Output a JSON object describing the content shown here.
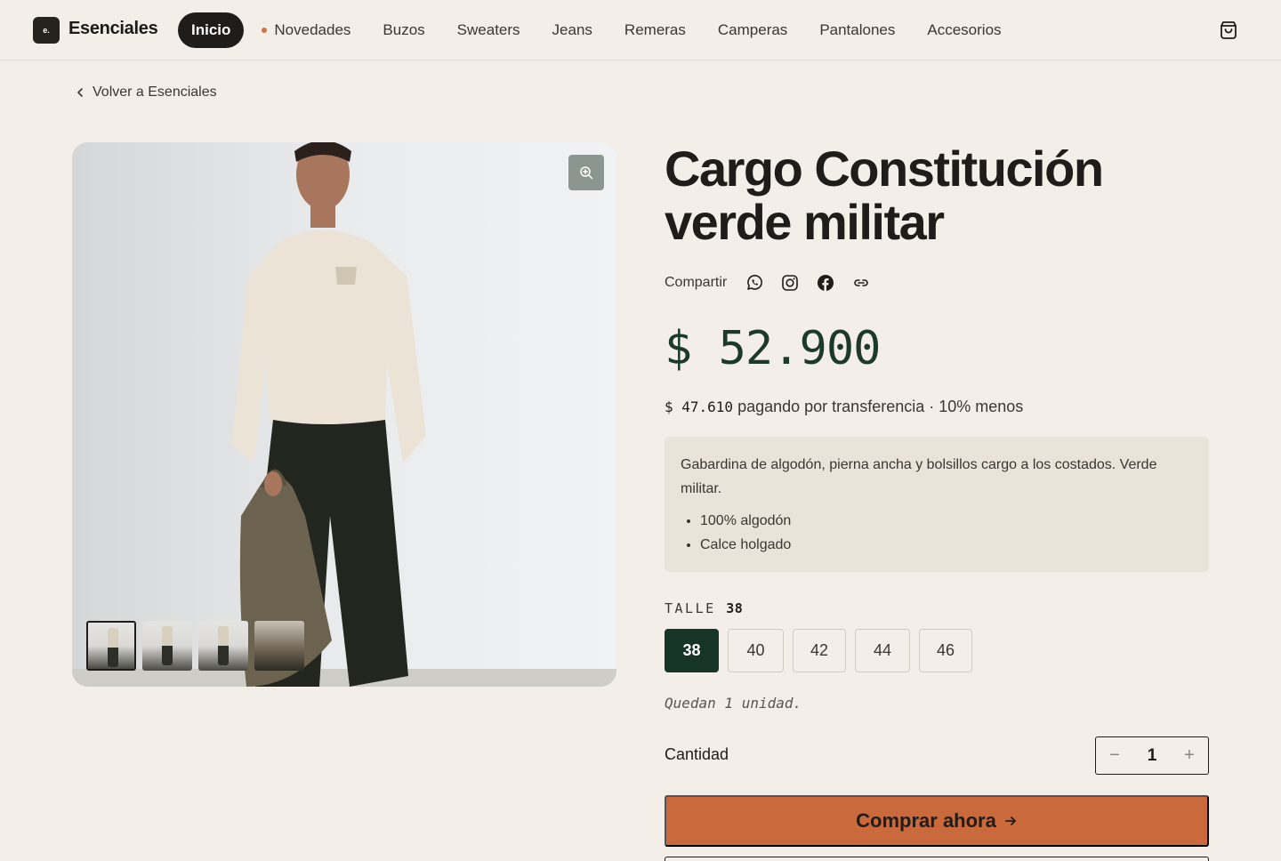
{
  "header": {
    "logo_text": "e.",
    "brand": "Esenciales",
    "nav": [
      {
        "label": "Inicio",
        "active": true
      },
      {
        "label": "Novedades",
        "dot": true
      },
      {
        "label": "Buzos"
      },
      {
        "label": "Sweaters"
      },
      {
        "label": "Jeans"
      },
      {
        "label": "Remeras"
      },
      {
        "label": "Camperas"
      },
      {
        "label": "Pantalones"
      },
      {
        "label": "Accesorios"
      }
    ],
    "cart_icon": "shopping-bag-icon"
  },
  "back_link": "Volver a Esenciales",
  "gallery": {
    "zoom_icon": "zoom-in-icon",
    "thumbnail_count": 4,
    "selected_thumbnail": 1
  },
  "product": {
    "title": "Cargo Constitución verde militar",
    "share_label": "Compartir",
    "share_icons": [
      "whatsapp-icon",
      "instagram-icon",
      "facebook-icon",
      "link-icon"
    ],
    "price": "$ 52.900",
    "transfer_price": "$ 47.610",
    "transfer_text": "pagando por transferencia · 10% menos",
    "description": "Gabardina de algodón, pierna ancha y bolsillos cargo a los costados. Verde militar.",
    "features": [
      "100% algodón",
      "Calce holgado"
    ],
    "size_label": "TALLE",
    "selected_size": "38",
    "sizes": [
      "38",
      "40",
      "42",
      "44",
      "46"
    ],
    "stock_text": "Quedan 1 unidad.",
    "quantity_label": "Cantidad",
    "quantity": "1",
    "buy_label": "Comprar ahora"
  },
  "colors": {
    "background": "#f3efe8",
    "accent": "#c9693c",
    "price_green": "#1d3a28",
    "selected_size": "#173526"
  }
}
